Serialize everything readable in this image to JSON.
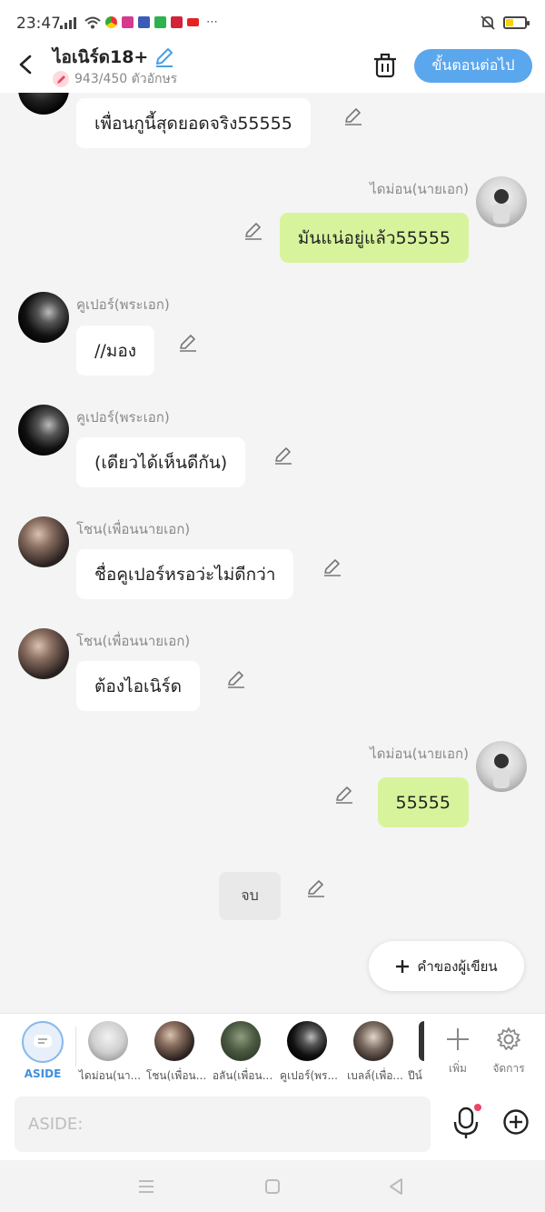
{
  "status_bar": {
    "time": "23:47",
    "battery_level_fraction": 0.35
  },
  "header": {
    "title": "ไอเนิร์ด18+",
    "char_count": "943/450 ตัวอักษร",
    "next_button": "ขั้นตอนต่อไป"
  },
  "messages": [
    {
      "side": "left",
      "name": "",
      "text": "เพื่อนกูนี้สุดยอดจริง55555",
      "avatar": "dark"
    },
    {
      "side": "right",
      "name": "ไดม่อน(นายเอก)",
      "text": "มันแน่อยู่แล้ว55555",
      "avatar": "light"
    },
    {
      "side": "left",
      "name": "คูเปอร์(พระเอก)",
      "text": "//มอง",
      "avatar": "dark"
    },
    {
      "side": "left",
      "name": "คูเปอร์(พระเอก)",
      "text": "(เดียวได้เห็นดีกัน)",
      "avatar": "dark"
    },
    {
      "side": "left",
      "name": "โชน(เพื่อนนายเอก)",
      "text": "ชื่อคูเปอร์หรอว่ะไม่ดีกว่า",
      "avatar": "mid"
    },
    {
      "side": "left",
      "name": "โชน(เพื่อนนายเอก)",
      "text": "ต้องไอเนิร์ด",
      "avatar": "mid"
    },
    {
      "side": "right",
      "name": "ไดม่อน(นายเอก)",
      "text": "55555",
      "avatar": "light"
    }
  ],
  "end_label": "จบ",
  "author_button": "คำของผู้เขียน",
  "character_bar": {
    "aside_label": "ASIDE",
    "characters": [
      "ไดม่อน(นา...",
      "โชน(เพื่อน...",
      "อลัน(เพื่อน...",
      "คูเปอร์(พร...",
      "เบลล์(เพื่อ...",
      "ปีน์"
    ],
    "add_label": "เพิ่ม",
    "manage_label": "จัดการ"
  },
  "input": {
    "placeholder": "ASIDE:"
  },
  "colors": {
    "accent": "#5aa7ee",
    "right_bubble": "#d7f49c",
    "left_bubble": "#ffffff",
    "background": "#f4f4f4"
  },
  "icons": [
    "back-arrow-icon",
    "edit-pencil-icon",
    "trash-icon",
    "plus-icon",
    "gear-icon",
    "mic-icon",
    "add-circle-icon",
    "chat-bubble-icon",
    "menu-icon",
    "home-square-icon",
    "back-triangle-icon"
  ]
}
